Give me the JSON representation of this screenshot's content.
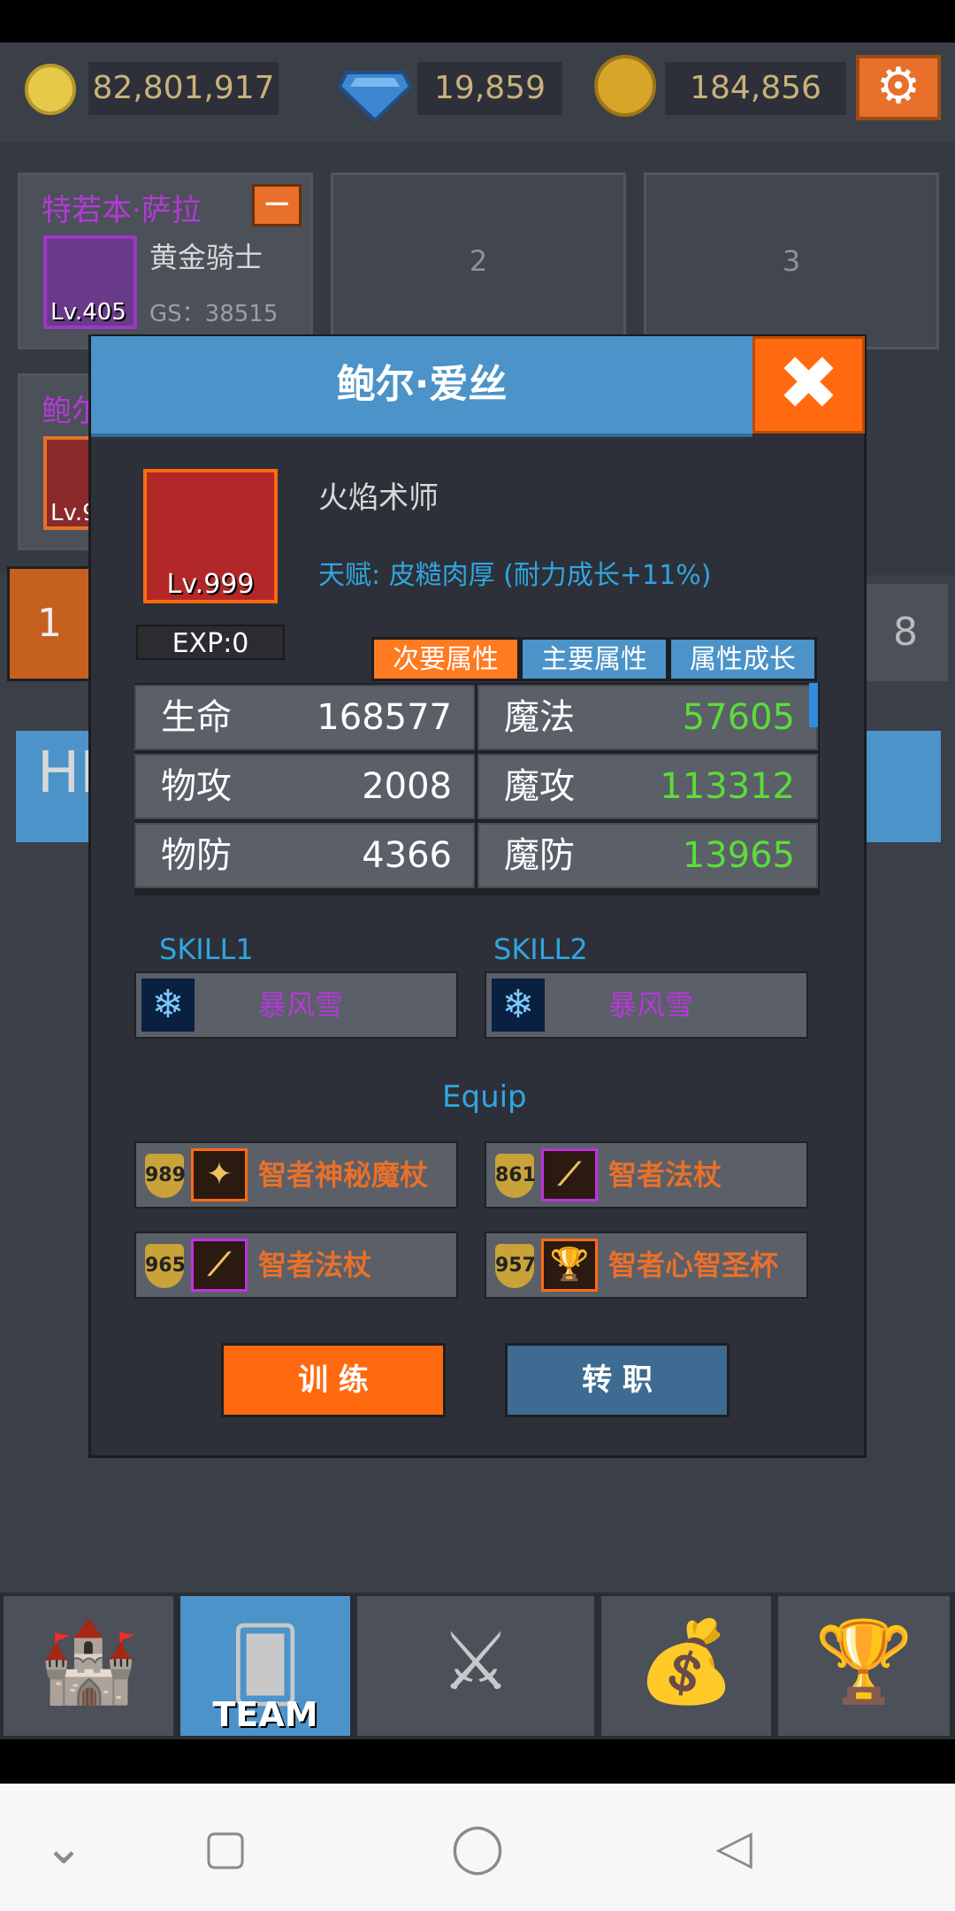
{
  "resources": {
    "gold": "82,801,917",
    "gems": "19,859",
    "medals": "184,856"
  },
  "team_slots": [
    {
      "name": "特若本·萨拉",
      "class": "黄金骑士",
      "level": "Lv.405",
      "gs": "GS：38515"
    },
    {
      "label": "2"
    },
    {
      "label": "3"
    }
  ],
  "partial_hero": {
    "name": "鲍尔",
    "level": "Lv.9"
  },
  "back_tiles": {
    "left_num": "1",
    "right_num": "8",
    "hi_text": "HI"
  },
  "modal": {
    "title": "鲍尔·爱丝",
    "close_symbol": "✖",
    "portrait_level": "Lv.999",
    "class_name": "火焰术师",
    "talent": "天赋: 皮糙肉厚 (耐力成长+11%)",
    "exp": "EXP:0",
    "tabs": [
      "次要属性",
      "主要属性",
      "属性成长"
    ],
    "stats": [
      {
        "label": "生命",
        "value": "168577"
      },
      {
        "label": "魔法",
        "value": "57605"
      },
      {
        "label": "物攻",
        "value": "2008"
      },
      {
        "label": "魔攻",
        "value": "113312"
      },
      {
        "label": "物防",
        "value": "4366"
      },
      {
        "label": "魔防",
        "value": "13965"
      }
    ],
    "skills": [
      {
        "label": "SKILL1",
        "name": "暴风雪"
      },
      {
        "label": "SKILL2",
        "name": "暴风雪"
      }
    ],
    "equip_title": "Equip",
    "equips": [
      {
        "level": "989",
        "name": "智者神秘魔杖"
      },
      {
        "level": "861",
        "name": "智者法杖"
      },
      {
        "level": "965",
        "name": "智者法杖"
      },
      {
        "level": "957",
        "name": "智者心智圣杯"
      }
    ],
    "buttons": {
      "train": "训 练",
      "transfer": "转 职"
    }
  },
  "nav": {
    "team_label": "TEAM"
  },
  "colors": {
    "accent_orange": "#ff6a10",
    "accent_blue": "#4b93c8",
    "stat_green": "#5cdc3a",
    "name_purple": "#b43ad6"
  }
}
